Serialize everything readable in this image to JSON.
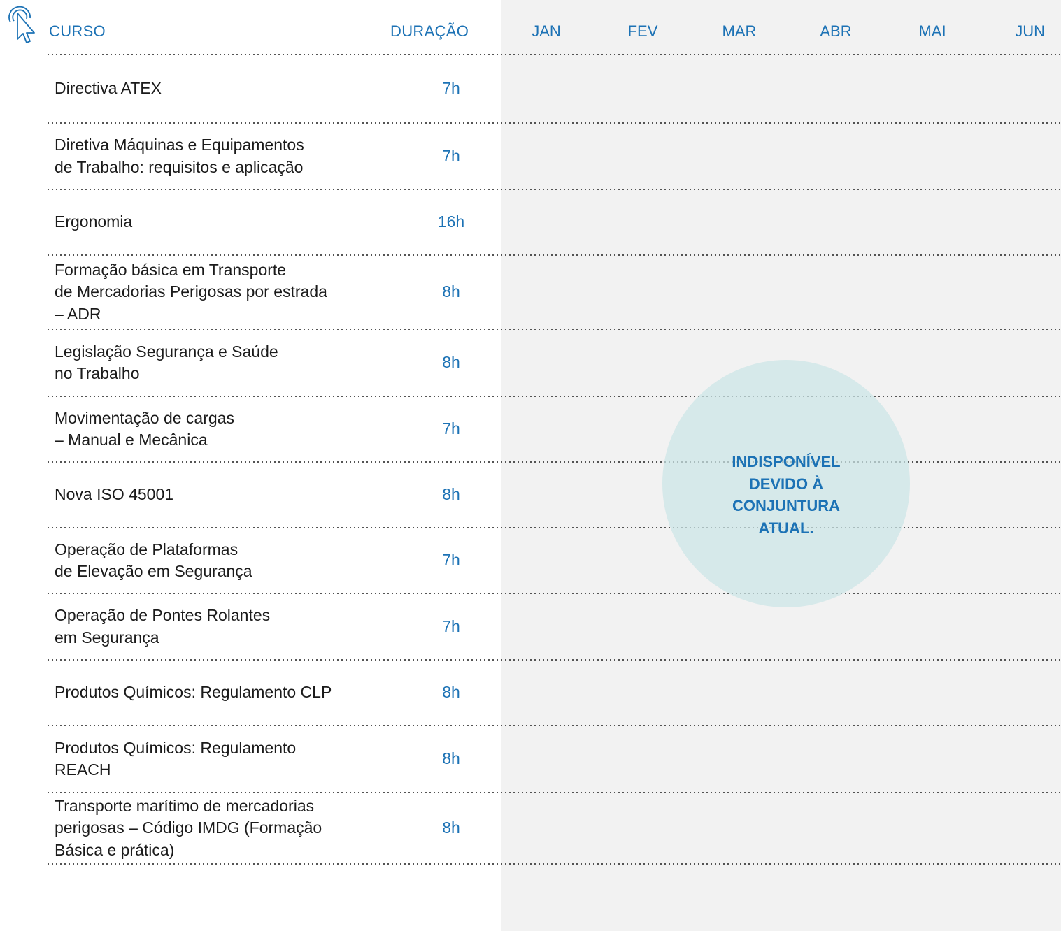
{
  "header": {
    "course_label": "CURSO",
    "duration_label": "DURAÇÃO",
    "months": [
      "JAN",
      "FEV",
      "MAR",
      "ABR",
      "MAI",
      "JUN"
    ]
  },
  "icons": {
    "header_icon": "click-pointer-icon"
  },
  "courses": [
    {
      "name": "Directiva ATEX",
      "duration": "7h"
    },
    {
      "name": "Diretiva Máquinas e Equipamentos\nde Trabalho: requisitos e aplicação",
      "duration": "7h"
    },
    {
      "name": "Ergonomia",
      "duration": "16h"
    },
    {
      "name": "Formação básica em Transporte\nde Mercadorias Perigosas por estrada\n– ADR",
      "duration": "8h"
    },
    {
      "name": "Legislação Segurança e Saúde\nno Trabalho",
      "duration": "8h"
    },
    {
      "name": "Movimentação de cargas\n– Manual e Mecânica",
      "duration": "7h"
    },
    {
      "name": "Nova ISO 45001",
      "duration": "8h"
    },
    {
      "name": "Operação de Plataformas\nde Elevação em Segurança",
      "duration": "7h"
    },
    {
      "name": "Operação de Pontes Rolantes\nem Segurança",
      "duration": "7h"
    },
    {
      "name": "Produtos Químicos: Regulamento CLP",
      "duration": "8h"
    },
    {
      "name": "Produtos Químicos: Regulamento\nREACH",
      "duration": "8h"
    },
    {
      "name": "Transporte marítimo de mercadorias\nperigosas – Código IMDG (Formação\nBásica e prática)",
      "duration": "8h"
    }
  ],
  "notice": "INDISPONÍVEL\nDEVIDO À\nCONJUNTURA\nATUAL.",
  "colors": {
    "accent": "#1c72b5",
    "months_background": "#f2f2f2",
    "notice_circle": "#cae4e6"
  }
}
